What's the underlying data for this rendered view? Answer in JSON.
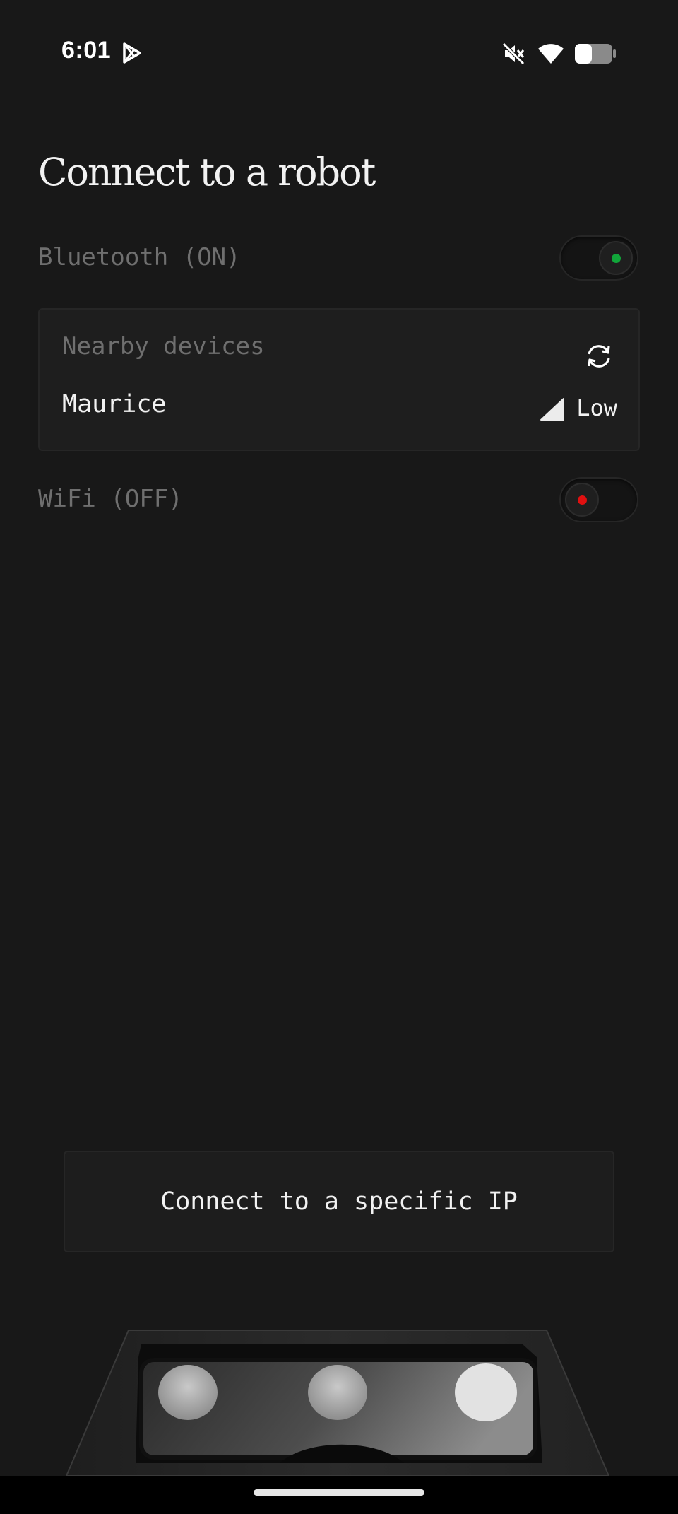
{
  "status_bar": {
    "time": "6:01",
    "icons": [
      "play-store-icon",
      "mute-icon",
      "wifi-icon",
      "battery-icon"
    ],
    "battery_level": 0.45
  },
  "page": {
    "title": "Connect to a robot"
  },
  "bluetooth": {
    "label": "Bluetooth (ON)",
    "enabled": true,
    "status_color": "#11a63a"
  },
  "nearby_devices": {
    "title": "Nearby devices",
    "refresh_icon": "refresh-icon",
    "devices": [
      {
        "name": "Maurice",
        "signal": "Low",
        "signal_icon": "signal-strength-icon"
      }
    ]
  },
  "wifi": {
    "label": "WiFi (OFF)",
    "enabled": false,
    "status_color": "#e01010"
  },
  "ip_button": {
    "label": "Connect to a specific IP"
  },
  "theme": {
    "background": "#181818",
    "panel": "#1e1e1e",
    "muted_text": "#6f6f6f",
    "text": "#f2f2f2"
  }
}
